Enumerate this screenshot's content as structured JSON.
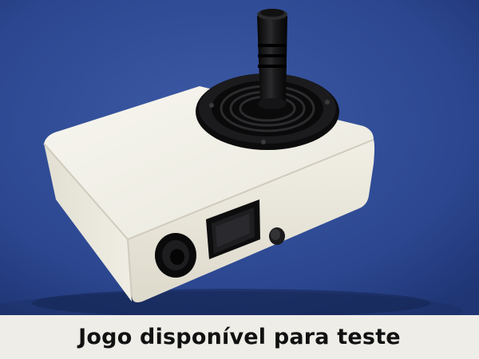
{
  "caption": {
    "text": "Jogo disponível para teste"
  },
  "photo": {
    "subject": "joystick-device",
    "colors": {
      "backdrop": "#2f4c96",
      "box": "#f1efe6",
      "plastic": "#0f0f10",
      "caption_bg": "#eeede8"
    }
  }
}
